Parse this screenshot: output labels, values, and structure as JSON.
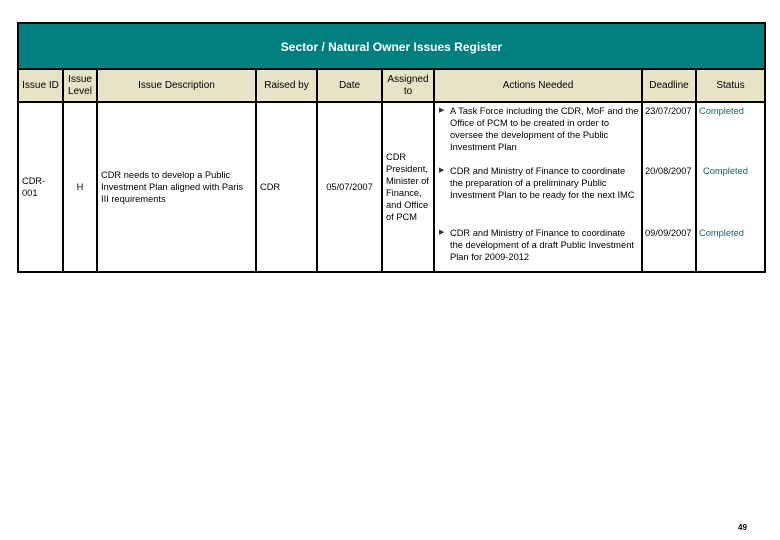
{
  "title": "Sector / Natural Owner Issues Register",
  "columns": [
    "Issue ID",
    "Issue Level",
    "Issue Description",
    "Raised by",
    "Date",
    "Assigned to",
    "Actions Needed",
    "Deadline",
    "Status"
  ],
  "issue": {
    "id": "CDR-001",
    "level": "H",
    "description": "CDR needs to develop a Public Investment Plan aligned with Paris III requirements",
    "raised_by": "CDR",
    "date": "05/07/2007",
    "assigned_to": "CDR President, Minister of Finance, and Office of PCM",
    "actions": [
      {
        "bullet_icon": "triangle-right",
        "text": "A Task Force including the CDR, MoF and the Office of PCM to be created in order to oversee the development of the Public Investment Plan",
        "deadline": "23/07/2007",
        "status": "Completed"
      },
      {
        "bullet_icon": "triangle-right",
        "text": "CDR and Ministry of Finance to coordinate the preparation of a preliminary Public Investment Plan to be ready for the next IMC",
        "deadline": "20/08/2007",
        "status": "Completed"
      },
      {
        "bullet_icon": "triangle-right",
        "text": "CDR and Ministry of Finance to coordinate the development of a draft Public Investment Plan for 2009-2012",
        "deadline": "09/09/2007",
        "status": "Completed"
      }
    ]
  },
  "colors": {
    "title_band": "#007f7f",
    "header_bg": "#e7e3c7",
    "status_text": "#1f5f5f"
  },
  "page_number": "49"
}
